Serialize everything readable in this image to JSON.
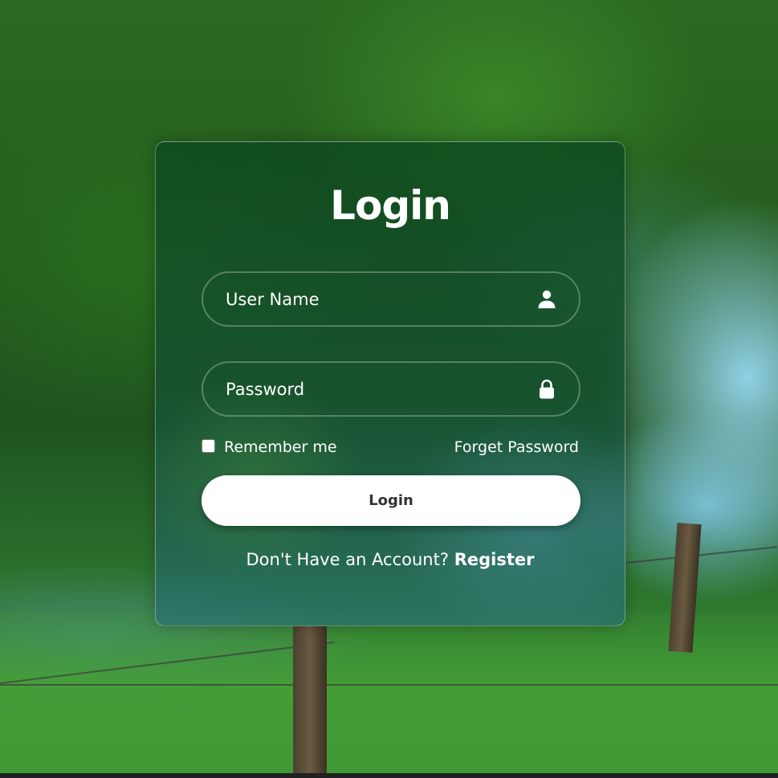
{
  "login_form": {
    "title": "Login",
    "username": {
      "placeholder": "User Name",
      "value": "",
      "icon": "user-icon"
    },
    "password": {
      "placeholder": "Password",
      "value": "",
      "icon": "lock-icon"
    },
    "remember_label": "Remember me",
    "remember_checked": false,
    "forgot_label": "Forget Password",
    "submit_label": "Login",
    "register_prompt": "Don't Have an Account?",
    "register_link": "Register"
  },
  "colors": {
    "text": "#ffffff",
    "button_bg": "#ffffff",
    "button_text": "#333333"
  }
}
